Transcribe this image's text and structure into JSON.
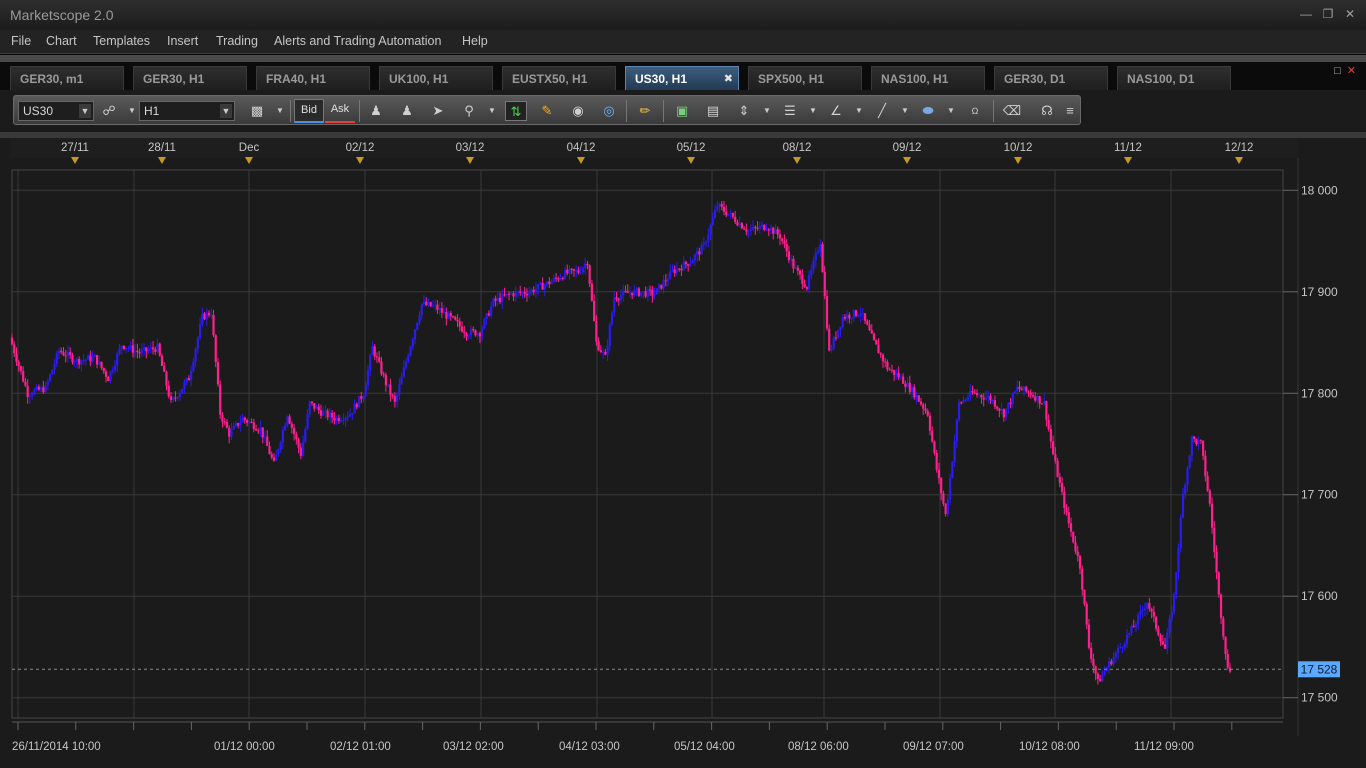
{
  "window": {
    "title": "Marketscope 2.0"
  },
  "menu": [
    "File",
    "Chart",
    "Templates",
    "Insert",
    "Trading",
    "Alerts and Trading Automation",
    "Help"
  ],
  "tabs": [
    {
      "label": "GER30, m1",
      "active": false
    },
    {
      "label": "GER30, H1",
      "active": false
    },
    {
      "label": "FRA40, H1",
      "active": false
    },
    {
      "label": "UK100, H1",
      "active": false
    },
    {
      "label": "EUSTX50, H1",
      "active": false
    },
    {
      "label": "US30, H1",
      "active": true
    },
    {
      "label": "SPX500, H1",
      "active": false
    },
    {
      "label": "NAS100, H1",
      "active": false
    },
    {
      "label": "GER30, D1",
      "active": false
    },
    {
      "label": "NAS100, D1",
      "active": false
    }
  ],
  "toolbar": {
    "instrument": "US30",
    "timeframe": "H1",
    "bid_label": "Bid",
    "ask_label": "Ask"
  },
  "colors": {
    "up_candle": "#2a1cf0",
    "down_candle": "#ff1f8e",
    "background": "#1b1b1b",
    "grid": "#3a3a3a",
    "current_price_badge": "#5aa9ff",
    "day_marker": "#c89a1e"
  },
  "chart_data": {
    "type": "candlestick",
    "instrument": "US30",
    "timeframe": "H1",
    "ylim": [
      17480,
      18020
    ],
    "y_ticks": [
      "18 000",
      "17 900",
      "17 800",
      "17 700",
      "17 600",
      "17 500"
    ],
    "y_tick_values": [
      18000,
      17900,
      17800,
      17700,
      17600,
      17500
    ],
    "current_price": 17528,
    "current_price_label": "17 528",
    "top_axis_labels": [
      "27/11",
      "28/11",
      "Dec",
      "02/12",
      "03/12",
      "04/12",
      "05/12",
      "08/12",
      "09/12",
      "10/12",
      "11/12",
      "12/12"
    ],
    "bottom_axis_labels": [
      "26/11/2014 10:00",
      "01/12 00:00",
      "02/12 01:00",
      "03/12 02:00",
      "04/12 03:00",
      "05/12 04:00",
      "08/12 06:00",
      "09/12 07:00",
      "10/12 08:00",
      "11/12 09:00"
    ],
    "price_path": [
      [
        0,
        17855
      ],
      [
        8,
        17800
      ],
      [
        16,
        17805
      ],
      [
        22,
        17842
      ],
      [
        30,
        17832
      ],
      [
        38,
        17835
      ],
      [
        44,
        17815
      ],
      [
        50,
        17848
      ],
      [
        58,
        17840
      ],
      [
        66,
        17845
      ],
      [
        72,
        17790
      ],
      [
        80,
        17815
      ],
      [
        86,
        17875
      ],
      [
        90,
        17880
      ],
      [
        94,
        17780
      ],
      [
        98,
        17760
      ],
      [
        104,
        17775
      ],
      [
        112,
        17765
      ],
      [
        118,
        17730
      ],
      [
        124,
        17780
      ],
      [
        130,
        17740
      ],
      [
        134,
        17790
      ],
      [
        140,
        17780
      ],
      [
        146,
        17775
      ],
      [
        152,
        17780
      ],
      [
        158,
        17800
      ],
      [
        162,
        17845
      ],
      [
        168,
        17810
      ],
      [
        172,
        17790
      ],
      [
        178,
        17840
      ],
      [
        184,
        17888
      ],
      [
        190,
        17885
      ],
      [
        198,
        17872
      ],
      [
        204,
        17860
      ],
      [
        210,
        17860
      ],
      [
        216,
        17890
      ],
      [
        224,
        17898
      ],
      [
        232,
        17900
      ],
      [
        240,
        17908
      ],
      [
        248,
        17918
      ],
      [
        254,
        17920
      ],
      [
        258,
        17930
      ],
      [
        262,
        17850
      ],
      [
        266,
        17835
      ],
      [
        270,
        17895
      ],
      [
        278,
        17900
      ],
      [
        288,
        17898
      ],
      [
        296,
        17920
      ],
      [
        304,
        17930
      ],
      [
        310,
        17945
      ],
      [
        316,
        17985
      ],
      [
        322,
        17975
      ],
      [
        330,
        17960
      ],
      [
        338,
        17965
      ],
      [
        344,
        17955
      ],
      [
        350,
        17925
      ],
      [
        356,
        17905
      ],
      [
        362,
        17950
      ],
      [
        366,
        17840
      ],
      [
        372,
        17875
      ],
      [
        380,
        17880
      ],
      [
        386,
        17850
      ],
      [
        392,
        17825
      ],
      [
        398,
        17815
      ],
      [
        404,
        17800
      ],
      [
        410,
        17780
      ],
      [
        414,
        17725
      ],
      [
        418,
        17680
      ],
      [
        424,
        17790
      ],
      [
        430,
        17800
      ],
      [
        438,
        17795
      ],
      [
        444,
        17780
      ],
      [
        450,
        17805
      ],
      [
        456,
        17800
      ],
      [
        462,
        17790
      ],
      [
        466,
        17740
      ],
      [
        472,
        17680
      ],
      [
        478,
        17630
      ],
      [
        482,
        17550
      ],
      [
        486,
        17515
      ],
      [
        490,
        17530
      ],
      [
        496,
        17550
      ],
      [
        502,
        17570
      ],
      [
        508,
        17595
      ],
      [
        512,
        17570
      ],
      [
        516,
        17548
      ],
      [
        520,
        17600
      ],
      [
        524,
        17700
      ],
      [
        528,
        17755
      ],
      [
        532,
        17750
      ],
      [
        536,
        17690
      ],
      [
        540,
        17600
      ],
      [
        544,
        17528
      ]
    ]
  }
}
